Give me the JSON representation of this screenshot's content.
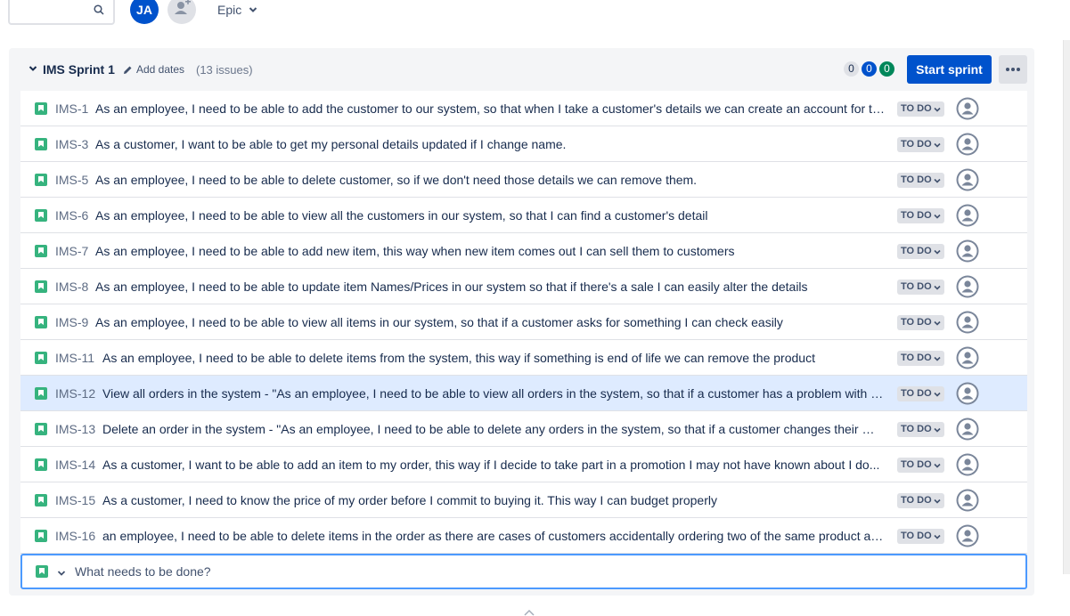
{
  "toolbar": {
    "avatar_initials": "JA",
    "epic_filter_label": "Epic"
  },
  "sprint": {
    "name": "IMS Sprint 1",
    "add_dates_label": "Add dates",
    "issue_count": "(13 issues)",
    "counts": {
      "todo": "0",
      "in_progress": "0",
      "done": "0"
    },
    "start_button_label": "Start sprint"
  },
  "issues": [
    {
      "key": "IMS-1",
      "summary": "As an employee, I need to be able to add the customer to our system, so that when I take a customer's details we can create an account for th...",
      "status": "TO DO"
    },
    {
      "key": "IMS-3",
      "summary": "As a customer, I want to be able to get my personal details updated if I change name.",
      "status": "TO DO"
    },
    {
      "key": "IMS-5",
      "summary": "As an employee, I need to be able to delete customer, so if we don't need those details we can remove them.",
      "status": "TO DO"
    },
    {
      "key": "IMS-6",
      "summary": "As an employee, I need to be able to view all the customers in our system, so that I can find a customer's detail",
      "status": "TO DO"
    },
    {
      "key": "IMS-7",
      "summary": "As an employee, I need to be able to add new item, this way when new item comes out I can sell them to customers",
      "status": "TO DO"
    },
    {
      "key": "IMS-8",
      "summary": "As an employee, I need to be able to update item Names/Prices in our system so that if there's a sale I can easily alter the details",
      "status": "TO DO"
    },
    {
      "key": "IMS-9",
      "summary": "As an employee, I need to be able to view all items in our system, so that if a customer asks for something I can check easily",
      "status": "TO DO"
    },
    {
      "key": "IMS-11",
      "summary": "As an employee, I need to be able to delete items from the system, this way if something is end of life we can remove the product",
      "status": "TO DO"
    },
    {
      "key": "IMS-12",
      "summary": "View all orders in the system - \"As an employee, I need to be able to view all orders in the system, so that if a customer has a problem with a...",
      "status": "TO DO"
    },
    {
      "key": "IMS-13",
      "summary": "Delete an order in the system - \"As an employee, I need to be able to delete any orders in the system, so that if a customer changes their min...",
      "status": "TO DO"
    },
    {
      "key": "IMS-14",
      "summary": "As a customer, I want to be able to add an item to my order, this way if I decide to take part in a promotion I may not have known about I do...",
      "status": "TO DO"
    },
    {
      "key": "IMS-15",
      "summary": "As a customer, I need to know the price of my order before I commit to buying it. This way I can budget properly",
      "status": "TO DO"
    },
    {
      "key": "IMS-16",
      "summary": "an employee, I need to be able to delete items in the order as there are cases of customers accidentally ordering two of the same product an...",
      "status": "TO DO"
    }
  ],
  "selected_issue": "IMS-12",
  "new_issue": {
    "placeholder": "What needs to be done?"
  },
  "icons": {
    "search": "search-icon",
    "add_people": "add-people-icon",
    "chevron": "chevron-down-icon",
    "pencil": "pencil-icon",
    "story": "story-icon",
    "more": "more-icon",
    "assignee": "unassigned-avatar-icon"
  },
  "colors": {
    "primary": "#0052cc",
    "story": "#36b37e",
    "done": "#00875a",
    "selected_row": "#deebff",
    "focus_border": "#4c9aff"
  }
}
